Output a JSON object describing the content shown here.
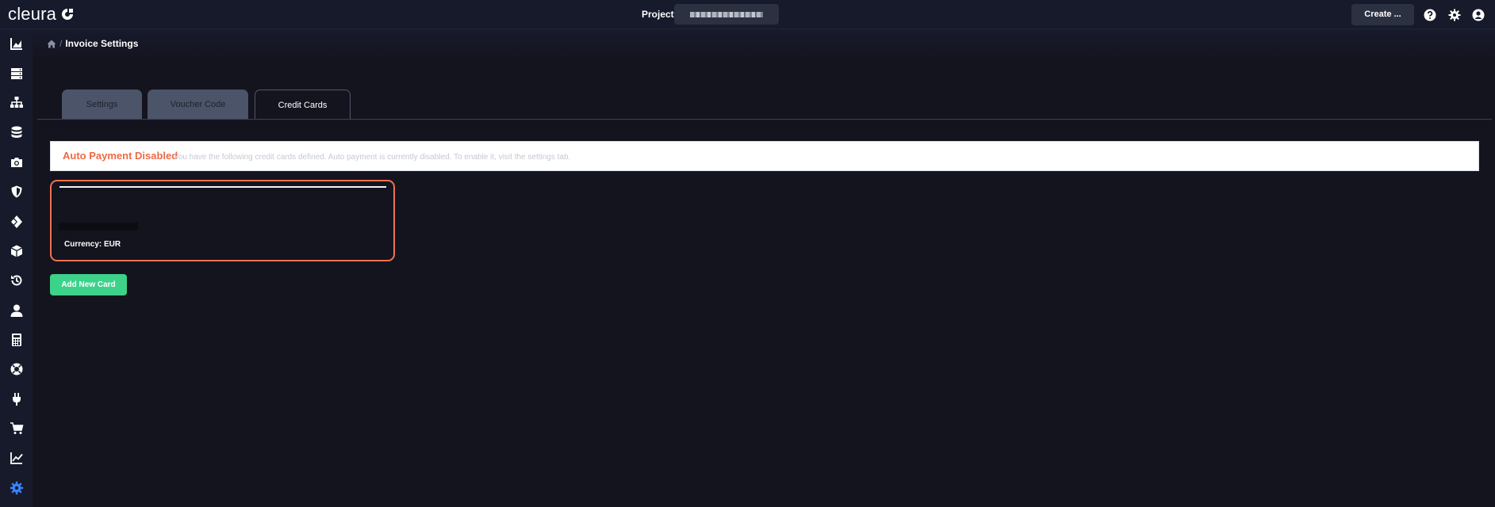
{
  "app": {
    "logo_text": "cleura",
    "project_label": "Project",
    "create_label": "Create ..."
  },
  "breadcrumb": {
    "separator": "/",
    "page_title": "Invoice Settings"
  },
  "tabs": [
    {
      "label": "Settings",
      "active": false
    },
    {
      "label": "Voucher Code",
      "active": false
    },
    {
      "label": "Credit Cards",
      "active": true
    }
  ],
  "alert": {
    "title": "Auto Payment Disabled",
    "message": "You have the following credit cards defined. Auto payment is currently disabled. To enable it, visit the settings tab."
  },
  "card": {
    "currency": "Currency: EUR"
  },
  "add_card_label": "Add New Card",
  "sidebar_icons": [
    "dashboard-chart-icon",
    "servers-icon",
    "network-icon",
    "storage-icon",
    "camera-icon",
    "shield-icon",
    "layers-icon",
    "cube-icon",
    "history-icon",
    "user-icon",
    "calculator-icon",
    "support-icon",
    "plug-icon",
    "cart-icon",
    "analytics-icon",
    "settings-gear-icon"
  ],
  "colors": {
    "accent_orange": "#ef6a45",
    "accent_green": "#3dd28a",
    "active_gear": "#3b82f6",
    "background": "#14141f",
    "bar": "#171a2b"
  }
}
